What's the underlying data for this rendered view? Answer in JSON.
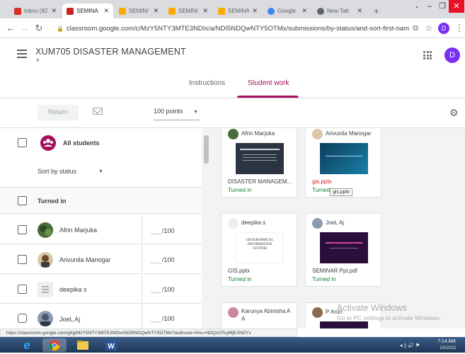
{
  "browser": {
    "tabs": [
      {
        "title": "Inbox (82",
        "color": "#d93025"
      },
      {
        "title": "SEMINA",
        "color": "#c5221f",
        "active": true
      },
      {
        "title": "SEMIN/",
        "color": "#f9ab00"
      },
      {
        "title": "SEMIN/",
        "color": "#f9ab00"
      },
      {
        "title": "SEMINA",
        "color": "#f9ab00"
      },
      {
        "title": "Google",
        "color": "#4285f4"
      },
      {
        "title": "New Tab",
        "color": "#5f6368"
      }
    ],
    "new_tab_label": "+",
    "url": "classroom.google.com/c/MzY5NTY3MTE3NDIx/a/NDI5NDQwNTY5OTMx/submissions/by-status/and-sort-first-name/...",
    "profile_initial": "D"
  },
  "classroom": {
    "course_title": "XUM705 DISASTER MANAGEMENT",
    "course_subtitle": "A",
    "user_initial": "D",
    "tabs": [
      "Instructions",
      "Student work"
    ],
    "active_tab": "Student work"
  },
  "toolbar": {
    "return_label": "Return",
    "points_value": "100 points"
  },
  "student_list": {
    "all_students_label": "All students",
    "sort_label": "Sort by status",
    "section_label": "Turned in",
    "students": [
      {
        "name": "Afrin Marjuka",
        "grade": "/100"
      },
      {
        "name": "Arivunila Manogar",
        "grade": "/100"
      },
      {
        "name": "deepika s",
        "grade": "/100"
      },
      {
        "name": "JoeL Aj",
        "grade": "/100"
      }
    ]
  },
  "submissions": [
    {
      "name": "Afrin Marjuka",
      "file": "DISASTER MANAGEM...",
      "status": "Turned in"
    },
    {
      "name": "Arivunila Manogar",
      "file": "gis.pptx",
      "status": "Turned in"
    },
    {
      "name": "deepika s",
      "file": "GIS.pptx",
      "status": "Turned in",
      "thumb_text": "GEOGRAPHICAL INFORMATION SYSTEM"
    },
    {
      "name": "JoeL Aj",
      "file": "SEMINAR Ppt.pdf",
      "status": "Turned in"
    },
    {
      "name": "Karunya Abinisha A A",
      "file": "",
      "status": ""
    },
    {
      "name": "P Arun",
      "file": "",
      "status": ""
    }
  ],
  "tooltip": "gis.pptx",
  "watermark": {
    "title": "Activate Windows",
    "subtitle": "Go to PC settings to activate Windows."
  },
  "status_url": "https://classroom.google.com/g/tg/MzY5NTY3MTE3NDIx/NDI5NDQwNTY5OTMx?authuser=0#u=NDQxOTcyMjE2NDYx",
  "taskbar": {
    "time": "7:14 AM",
    "date": "1/5/2022"
  }
}
